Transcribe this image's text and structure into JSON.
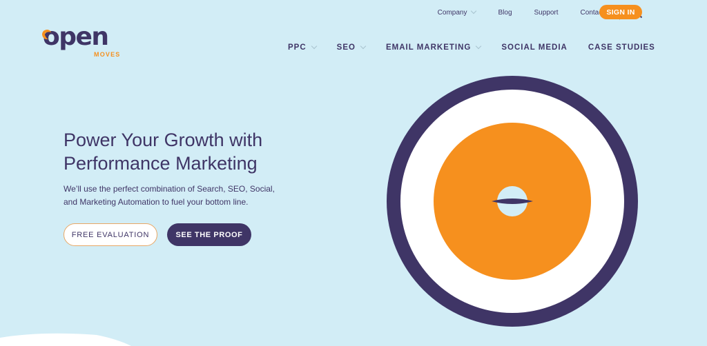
{
  "brand": {
    "logo_main": "open",
    "logo_sub": "MOVES",
    "accent_color": "#f6901e",
    "primary_color": "#3f3566",
    "background_color": "#d2edf6"
  },
  "utility_nav": {
    "items": [
      {
        "label": "Company",
        "has_dropdown": true
      },
      {
        "label": "Blog",
        "has_dropdown": false
      },
      {
        "label": "Support",
        "has_dropdown": false
      },
      {
        "label": "Contact",
        "has_dropdown": false
      }
    ],
    "search_icon": "search-icon",
    "signin_label": "SIGN IN"
  },
  "main_nav": {
    "items": [
      {
        "label": "PPC",
        "has_dropdown": true
      },
      {
        "label": "SEO",
        "has_dropdown": true
      },
      {
        "label": "EMAIL MARKETING",
        "has_dropdown": true
      },
      {
        "label": "SOCIAL MEDIA",
        "has_dropdown": false
      },
      {
        "label": "CASE STUDIES",
        "has_dropdown": false
      }
    ]
  },
  "hero": {
    "title_line1": "Power Your Growth with",
    "title_line2": "Performance Marketing",
    "subtitle_line1": "We’ll use the perfect combination of Search, SEO, Social,",
    "subtitle_line2": "and Marketing Automation to fuel your bottom line.",
    "cta_primary": "FREE EVALUATION",
    "cta_secondary": "SEE THE PROOF"
  },
  "graphic": {
    "type": "target-icon",
    "ring_colors": [
      "#3f3566",
      "#ffffff",
      "#f6901e",
      "#d2edf6"
    ]
  }
}
